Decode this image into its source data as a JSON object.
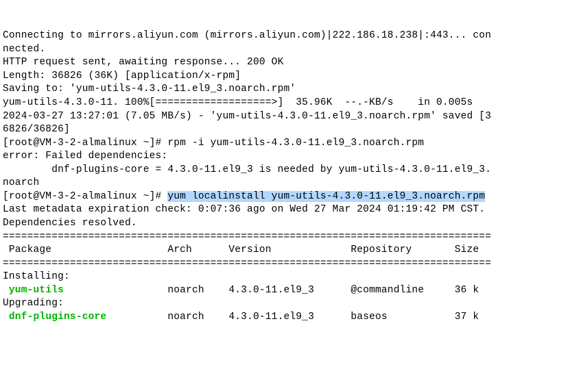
{
  "lines": {
    "l1": "Connecting to mirrors.aliyun.com (mirrors.aliyun.com)|222.186.18.238|:443... con",
    "l2": "nected.",
    "l3": "HTTP request sent, awaiting response... 200 OK",
    "l4": "Length: 36826 (36K) [application/x-rpm]",
    "l5": "Saving to: 'yum-utils-4.3.0-11.el9_3.noarch.rpm'",
    "l6": "",
    "l7": "yum-utils-4.3.0-11. 100%[===================>]  35.96K  --.-KB/s    in 0.005s",
    "l8": "",
    "l9": "2024-03-27 13:27:01 (7.05 MB/s) - 'yum-utils-4.3.0-11.el9_3.noarch.rpm' saved [3",
    "l10": "6826/36826]",
    "l11": "",
    "l12a": "[root@VM-3-2-almalinux ~]# ",
    "l12b": "rpm -i yum-utils-4.3.0-11.el9_3.noarch.rpm",
    "l13": "error: Failed dependencies:",
    "l14": "        dnf-plugins-core = 4.3.0-11.el9_3 is needed by yum-utils-4.3.0-11.el9_3.",
    "l15": "noarch",
    "l16a": "[root@VM-3-2-almalinux ~]# ",
    "l16b": "yum localinstall yum-utils-4.3.0-11.el9_3.noarch.rpm",
    "l17": "Last metadata expiration check: 0:07:36 ago on Wed 27 Mar 2024 01:19:42 PM CST.",
    "l18": "Dependencies resolved.",
    "l19": "================================================================================",
    "l20": " Package                   Arch      Version             Repository       Size",
    "l21": "================================================================================",
    "l22": "Installing:",
    "l23a": " ",
    "l23b": "yum-utils",
    "l23c": "                 noarch    4.3.0-11.el9_3      @commandline     36 k",
    "l24": "Upgrading:",
    "l25a": " ",
    "l25b": "dnf-plugins-core",
    "l25c": "          noarch    4.3.0-11.el9_3      baseos           37 k"
  }
}
